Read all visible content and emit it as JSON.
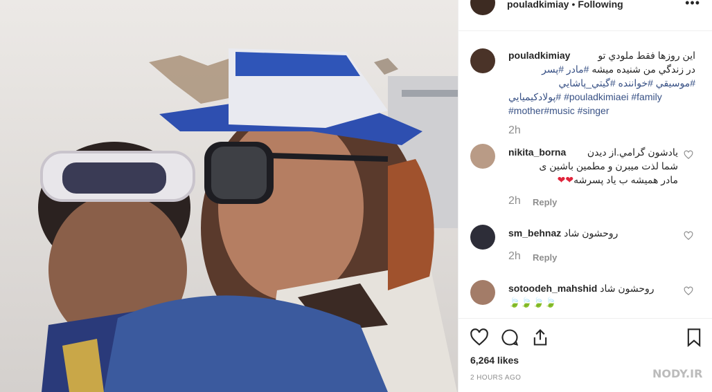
{
  "post": {
    "username": "pouladkimiay",
    "follow_status": "Following",
    "more_label": "•••"
  },
  "caption": {
    "username": "pouladkimiay",
    "line1": "اين روزها فقط ملودي تو",
    "line2": "در زندگي من شنيده ميشه",
    "tags_line2": "#مادر  #پسر",
    "tags_line3": "#موسيقي #خواننده  #گيتي_پاشايي",
    "tags_line4a": "#پولادكيميايي",
    "tags_line4b": "#pouladkimiaei #family",
    "tags_line5": "#mother#music #singer",
    "time": "2h"
  },
  "comments": [
    {
      "username": "nikita_borna",
      "text_l1": "يادشون گرامي.از ديدن",
      "text_l2": "شما لذت ميبرن و مطمين باشين ى",
      "text_l3": "مادر همیشه ب ياد پسرشه",
      "emoji": "❤❤",
      "time": "2h",
      "reply_label": "Reply"
    },
    {
      "username": "sm_behnaz",
      "text": "روحشون شاد",
      "time": "2h",
      "reply_label": "Reply"
    },
    {
      "username": "sotoodeh_mahshid",
      "text": "روحشون شاد",
      "emoji": "🍃🍃🍃🍃"
    }
  ],
  "footer": {
    "likes": "6,264 likes",
    "posted": "2 HOURS AGO"
  },
  "watermark": {
    "text": "NODY.IR"
  },
  "icons": {
    "like": "heart-icon",
    "comment": "comment-icon",
    "share": "share-icon",
    "save": "bookmark-icon"
  },
  "colors": {
    "tag": "#385185",
    "muted": "#8e8e8e",
    "heart": "#e0243b"
  }
}
